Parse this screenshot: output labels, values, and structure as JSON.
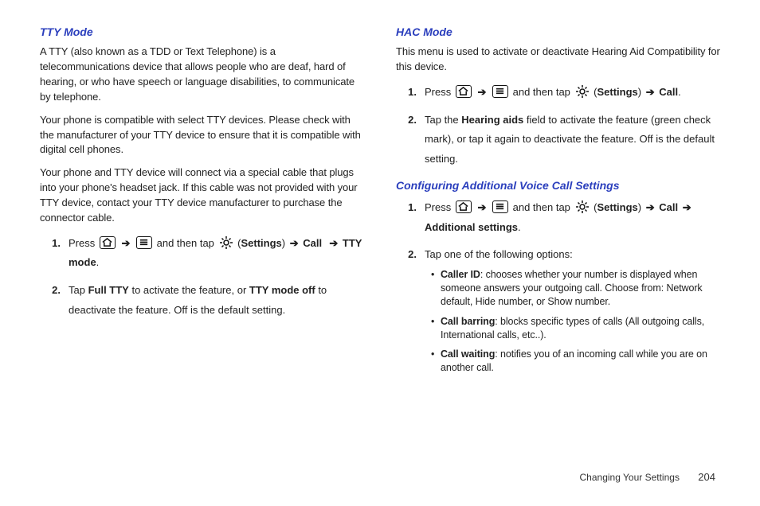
{
  "left": {
    "heading": "TTY Mode",
    "p1": "A TTY (also known as a TDD or Text Telephone) is a telecommunications device that allows people who are deaf, hard of hearing, or who have speech or language disabilities, to communicate by telephone.",
    "p2": "Your phone is compatible with select TTY devices. Please check with the manufacturer of your TTY device to ensure that it is compatible with digital cell phones.",
    "p3": "Your phone and TTY device will connect via a special cable that plugs into your phone's headset jack. If this cable was not provided with your TTY device, contact your TTY device manufacturer to purchase the connector cable.",
    "step1": {
      "press": "Press ",
      "then": " and then tap ",
      "settings_open": " (",
      "settings": "Settings",
      "settings_close": ") ",
      "call": "Call",
      "ttymode": "TTY mode",
      "period": "."
    },
    "step2": {
      "pre": "Tap ",
      "fulltty": "Full TTY",
      "mid": " to activate the feature, or ",
      "ttyoff": "TTY mode off",
      "post": " to deactivate the feature. Off is the default setting."
    }
  },
  "right": {
    "heading1": "HAC Mode",
    "p1": "This menu is used to activate or deactivate Hearing Aid Compatibility for this device.",
    "hac_step1": {
      "press": "Press ",
      "then": " and then tap ",
      "settings_open": " (",
      "settings": "Settings",
      "settings_close": ") ",
      "call": "Call",
      "period": "."
    },
    "hac_step2": {
      "pre": "Tap the ",
      "hearing": "Hearing aids",
      "post": " field to activate the feature (green check mark), or tap it again to deactivate the feature. Off is the default setting."
    },
    "heading2": "Configuring Additional Voice Call Settings",
    "cfg_step1": {
      "press": "Press ",
      "then": " and then tap ",
      "settings_open": " (",
      "settings": "Settings",
      "settings_close": ") ",
      "call": "Call",
      "addl": "Additional settings",
      "period": "."
    },
    "cfg_step2": "Tap one of the following options:",
    "bullets": [
      {
        "term": "Caller ID",
        "rest": ": chooses whether your number is displayed when someone answers your outgoing call. Choose from: Network default, Hide number, or Show number."
      },
      {
        "term": "Call barring",
        "rest": ": blocks specific types of calls (All outgoing calls, International calls, etc..)."
      },
      {
        "term": "Call waiting",
        "rest": ": notifies you of an incoming call while you are on another call."
      }
    ]
  },
  "footer": {
    "section": "Changing Your Settings",
    "page": "204"
  },
  "arrow": "➔"
}
